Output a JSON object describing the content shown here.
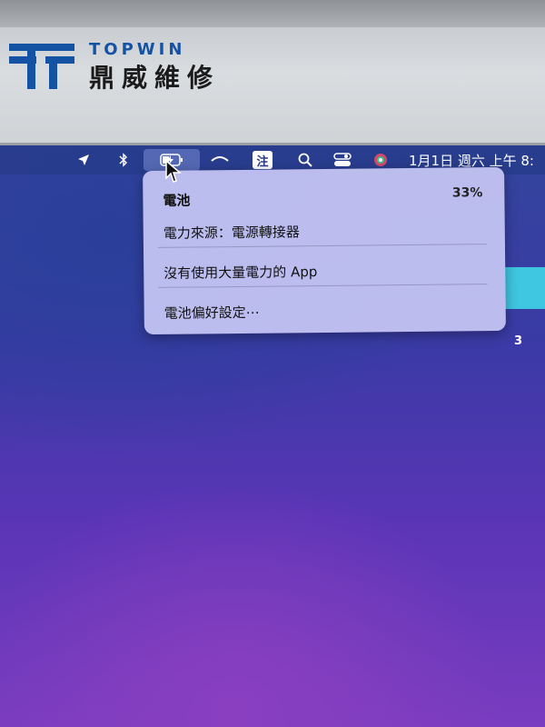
{
  "watermark": {
    "brand_en": "TOPWIN",
    "brand_cn": "鼎威維修",
    "logo_color": "#1452a3"
  },
  "menubar": {
    "icons": [
      "location-arrow-icon",
      "bluetooth-icon",
      "battery-charging-icon",
      "wifi-icon",
      "input-method-icon",
      "search-icon",
      "control-center-icon",
      "siri-icon"
    ],
    "input_method_label": "注",
    "clock": "1月1日 週六 上午 8:"
  },
  "battery_menu": {
    "title": "電池",
    "percent": "33%",
    "power_source": "電力來源：電源轉接器",
    "no_apps": "沒有使用大量電力的 App",
    "preferences": "電池偏好設定⋯"
  },
  "desktop": {
    "badge": "3",
    "accent_color": "#3fc6e0"
  }
}
